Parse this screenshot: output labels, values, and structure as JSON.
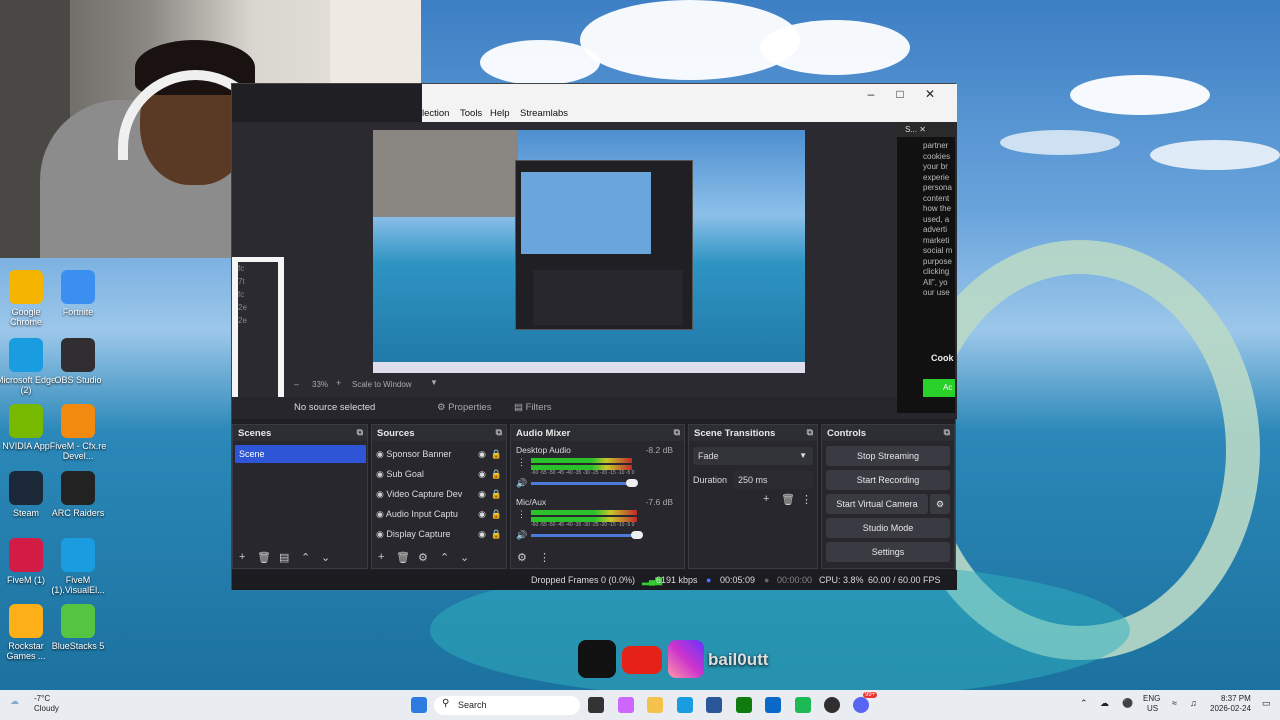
{
  "desktop_icons": [
    {
      "label": "Google Chrome",
      "icon": "chrome-icon",
      "color": "#f4b400"
    },
    {
      "label": "Fortnite",
      "icon": "fortnite-icon",
      "color": "#3b8ff0"
    },
    {
      "label": "Microsoft Edge (2)",
      "icon": "edge-icon",
      "color": "#1a9de0"
    },
    {
      "label": "OBS Studio",
      "icon": "obs-icon",
      "color": "#302e31"
    },
    {
      "label": "NVIDIA App",
      "icon": "nvidia-icon",
      "color": "#76b900"
    },
    {
      "label": "FiveM - Cfx.re Devel...",
      "icon": "fivem-icon",
      "color": "#f28a0f"
    },
    {
      "label": "Steam",
      "icon": "steam-icon",
      "color": "#1b2838"
    },
    {
      "label": "ARC Raiders",
      "icon": "arc-raiders-icon",
      "color": "#222222"
    },
    {
      "label": "FiveM (1)",
      "icon": "fivem-icon",
      "color": "#d21c45"
    },
    {
      "label": "FiveM (1).VisualEl...",
      "icon": "edge-icon",
      "color": "#1a9de0"
    },
    {
      "label": "Rockstar Games ...",
      "icon": "rockstar-icon",
      "color": "#fcaf17"
    },
    {
      "label": "BlueStacks 5",
      "icon": "bluestacks-icon",
      "color": "#55c541"
    }
  ],
  "obs": {
    "menu": [
      "lection",
      "Tools",
      "Help",
      "Streamlabs"
    ],
    "zoom": "33%",
    "scale_mode": "Scale to Window",
    "no_source": "No source selected",
    "properties": "Properties",
    "filters": "Filters",
    "scenes": {
      "title": "Scenes",
      "items": [
        "Scene"
      ]
    },
    "sources": {
      "title": "Sources",
      "items": [
        "Sponsor Banner",
        "Sub Goal",
        "Video Capture Dev",
        "Audio Input Captu",
        "Display Capture"
      ]
    },
    "mixer": {
      "title": "Audio Mixer",
      "channels": [
        {
          "name": "Desktop Audio",
          "db": "-8.2 dB",
          "level": 0.72
        },
        {
          "name": "Mic/Aux",
          "db": "-7.6 dB",
          "level": 0.76
        }
      ],
      "scale": "-60 -55 -50 -45 -40 -35 -30 -25 -20 -15 -10 -5 0"
    },
    "transitions": {
      "title": "Scene Transitions",
      "selected": "Fade",
      "duration_label": "Duration",
      "duration_value": "250 ms"
    },
    "controls": {
      "title": "Controls",
      "buttons": [
        "Stop Streaming",
        "Start Recording",
        "Start Virtual Camera",
        "Studio Mode",
        "Settings"
      ]
    },
    "status": {
      "dropped": "Dropped Frames 0 (0.0%)",
      "bitrate": "6191 kbps",
      "live_time": "00:05:09",
      "rec_time": "00:00:00",
      "cpu": "CPU: 3.8%",
      "fps": "60.00 / 60.00 FPS"
    }
  },
  "cookie": {
    "header": "S...",
    "text": "partner cookies your br experie persona content how the used, a adverti marketi social m purpose clicking All\", yo our use",
    "heading": "Cook",
    "button": "Ac"
  },
  "left_panel_texts": [
    "fc",
    "7t",
    "fc",
    "2e",
    "2e"
  ],
  "social": {
    "handle": "bail0utt"
  },
  "taskbar": {
    "weather_temp": "-7°C",
    "weather_desc": "Cloudy",
    "search": "Search",
    "lang1": "ENG",
    "lang2": "US",
    "time": "8:37 PM",
    "date": "2026-02-24",
    "badge": "99+"
  }
}
